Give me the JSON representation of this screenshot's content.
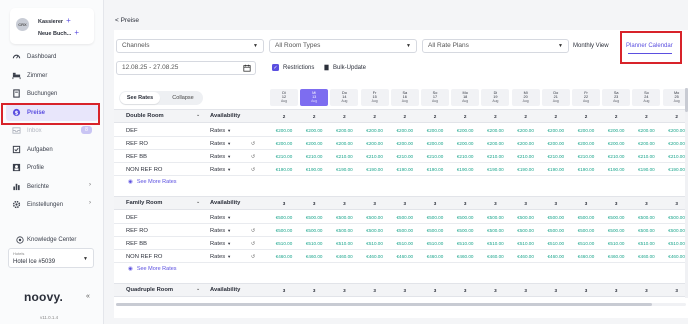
{
  "sidebar": {
    "user": {
      "initials": "CRX",
      "line1": "Kassierer",
      "line2": "Neue Buch..."
    },
    "items": [
      {
        "label": "Dashboard",
        "icon": "gauge-icon"
      },
      {
        "label": "Zimmer",
        "icon": "bed-icon"
      },
      {
        "label": "Buchungen",
        "icon": "book-icon"
      },
      {
        "label": "Preise",
        "icon": "price-tag-icon",
        "active": true
      },
      {
        "label": "Inbox",
        "icon": "inbox-icon",
        "badge": "8",
        "disabled": true
      },
      {
        "label": "Aufgaben",
        "icon": "tasks-icon"
      },
      {
        "label": "Profile",
        "icon": "profile-icon"
      },
      {
        "label": "Berichte",
        "icon": "chart-icon",
        "chevron": true
      },
      {
        "label": "Einstellungen",
        "icon": "gear-icon",
        "chevron": true
      }
    ],
    "knowledge_center": "Knowledge Center",
    "hotel": {
      "label": "Hotels",
      "value": "Hotel Ice #5039"
    },
    "logo": "noovy.",
    "version": "v11.0.1.4"
  },
  "header": {
    "back_label": "< Preise"
  },
  "filters": {
    "channels": "Channels",
    "room_types": "All Room Types",
    "rate_plans": "All Rate Plans",
    "monthly_view": "Monthly View",
    "planner_calendar": "Planner Calendar",
    "date_range": "12.08.25 - 27.08.25",
    "restrictions": "Restrictions",
    "bulk_update": "Bulk-Update"
  },
  "toggle": {
    "see_rates": "See Rates",
    "collapse": "Collapse"
  },
  "dates": [
    {
      "dow": "Di",
      "day": "12",
      "mon": "Aug"
    },
    {
      "dow": "Mi",
      "day": "13",
      "mon": "Aug",
      "today": true
    },
    {
      "dow": "Do",
      "day": "14",
      "mon": "Aug"
    },
    {
      "dow": "Fr",
      "day": "15",
      "mon": "Aug"
    },
    {
      "dow": "Sa",
      "day": "16",
      "mon": "Aug"
    },
    {
      "dow": "So",
      "day": "17",
      "mon": "Aug"
    },
    {
      "dow": "Mo",
      "day": "18",
      "mon": "Aug"
    },
    {
      "dow": "Di",
      "day": "19",
      "mon": "Aug"
    },
    {
      "dow": "Mi",
      "day": "20",
      "mon": "Aug"
    },
    {
      "dow": "Do",
      "day": "21",
      "mon": "Aug"
    },
    {
      "dow": "Fr",
      "day": "22",
      "mon": "Aug"
    },
    {
      "dow": "Sa",
      "day": "23",
      "mon": "Aug"
    },
    {
      "dow": "So",
      "day": "24",
      "mon": "Aug"
    },
    {
      "dow": "Mo",
      "day": "25",
      "mon": "Aug"
    }
  ],
  "labels": {
    "availability": "Availability",
    "rates": "Rates",
    "see_more": "See More Rates"
  },
  "rooms": [
    {
      "name": "Double Room",
      "availability": [
        "2",
        "2",
        "2",
        "2",
        "2",
        "2",
        "2",
        "2",
        "2",
        "2",
        "2",
        "2",
        "2",
        "2"
      ],
      "plans": [
        {
          "name": "DEF",
          "rates_cell": false,
          "values": [
            "€200.00",
            "€200.00",
            "€200.00",
            "€200.00",
            "€200.00",
            "€200.00",
            "€200.00",
            "€200.00",
            "€200.00",
            "€200.00",
            "€200.00",
            "€200.00",
            "€200.00",
            "€200.00"
          ]
        },
        {
          "name": "REF RO",
          "rates_cell": true,
          "values": [
            "€200.00",
            "€200.00",
            "€200.00",
            "€200.00",
            "€200.00",
            "€200.00",
            "€200.00",
            "€200.00",
            "€200.00",
            "€200.00",
            "€200.00",
            "€200.00",
            "€200.00",
            "€200.00"
          ]
        },
        {
          "name": "REF BB",
          "rates_cell": true,
          "values": [
            "€210.00",
            "€210.00",
            "€210.00",
            "€210.00",
            "€210.00",
            "€210.00",
            "€210.00",
            "€210.00",
            "€210.00",
            "€210.00",
            "€210.00",
            "€210.00",
            "€210.00",
            "€210.00"
          ]
        },
        {
          "name": "NON REF RO",
          "rates_cell": true,
          "values": [
            "€190.00",
            "€190.00",
            "€190.00",
            "€190.00",
            "€190.00",
            "€190.00",
            "€190.00",
            "€190.00",
            "€190.00",
            "€190.00",
            "€190.00",
            "€190.00",
            "€190.00",
            "€190.00"
          ]
        }
      ]
    },
    {
      "name": "Family Room",
      "availability": [
        "3",
        "3",
        "3",
        "3",
        "3",
        "3",
        "3",
        "3",
        "3",
        "3",
        "3",
        "3",
        "3",
        "3"
      ],
      "plans": [
        {
          "name": "DEF",
          "rates_cell": false,
          "values": [
            "€500.00",
            "€500.00",
            "€500.00",
            "€500.00",
            "€500.00",
            "€500.00",
            "€500.00",
            "€500.00",
            "€500.00",
            "€500.00",
            "€500.00",
            "€500.00",
            "€500.00",
            "€500.00"
          ]
        },
        {
          "name": "REF RO",
          "rates_cell": true,
          "values": [
            "€500.00",
            "€500.00",
            "€500.00",
            "€500.00",
            "€500.00",
            "€500.00",
            "€500.00",
            "€500.00",
            "€500.00",
            "€500.00",
            "€500.00",
            "€500.00",
            "€500.00",
            "€500.00"
          ]
        },
        {
          "name": "REF BB",
          "rates_cell": true,
          "values": [
            "€510.00",
            "€510.00",
            "€510.00",
            "€510.00",
            "€510.00",
            "€510.00",
            "€510.00",
            "€510.00",
            "€510.00",
            "€510.00",
            "€510.00",
            "€510.00",
            "€510.00",
            "€510.00"
          ]
        },
        {
          "name": "NON REF RO",
          "rates_cell": true,
          "values": [
            "€460.00",
            "€460.00",
            "€460.00",
            "€460.00",
            "€460.00",
            "€460.00",
            "€460.00",
            "€460.00",
            "€460.00",
            "€460.00",
            "€460.00",
            "€460.00",
            "€460.00",
            "€460.00"
          ]
        }
      ]
    },
    {
      "name": "Quadruple Room",
      "availability": [
        "3",
        "3",
        "3",
        "3",
        "3",
        "3",
        "3",
        "3",
        "3",
        "3",
        "3",
        "3",
        "3",
        "3"
      ],
      "plans": []
    }
  ],
  "colors": {
    "accent": "#5b4fe0",
    "price": "#1aa58c",
    "highlight": "#d8232a"
  }
}
